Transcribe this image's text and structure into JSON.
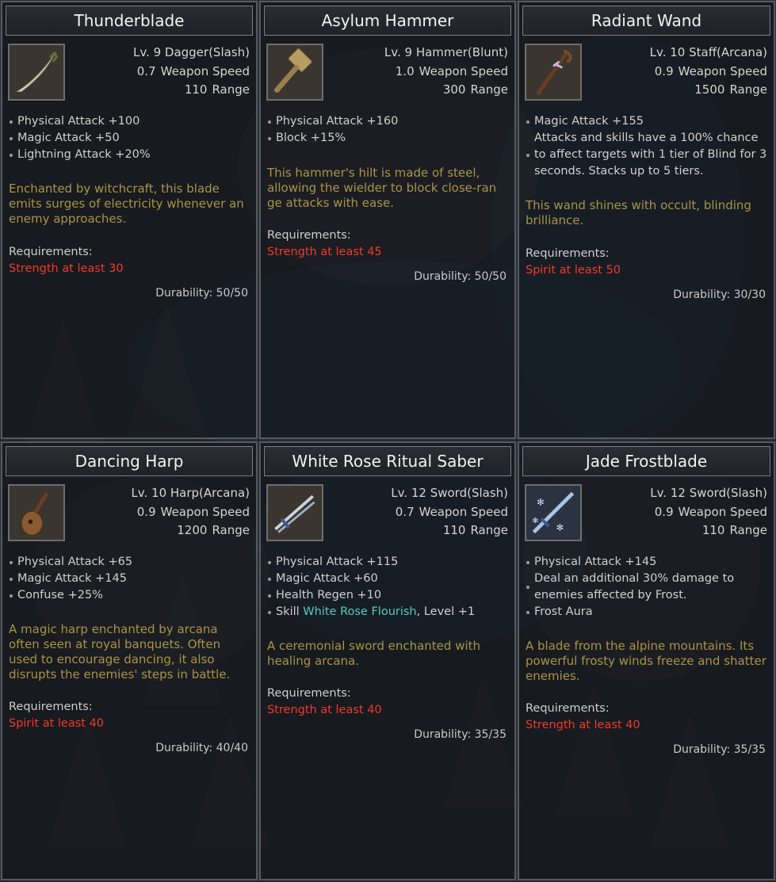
{
  "items": [
    {
      "name": "Thunderblade",
      "icon": "dagger-icon",
      "level_type": "Lv. 9 Dagger(Slash)",
      "speed_value": "0.7",
      "speed_label": "Weapon Speed",
      "range_value": "110",
      "range_label": "Range",
      "attributes": [
        "Physical Attack +100",
        "Magic Attack +50",
        "Lightning Attack +20%"
      ],
      "description": "Enchanted by witchcraft, this blade emits surges of electricity whenever an enemy approaches.",
      "requirements_label": "Requirements:",
      "requirement": "Strength at least 30",
      "durability": "Durability: 50/50"
    },
    {
      "name": "Asylum Hammer",
      "icon": "hammer-icon",
      "level_type": "Lv. 9 Hammer(Blunt)",
      "speed_value": "1.0",
      "speed_label": "Weapon Speed",
      "range_value": "300",
      "range_label": "Range",
      "attributes": [
        "Physical Attack +160",
        "Block +15%"
      ],
      "description": "This hammer's hilt is made of steel, allowing the wielder to block close-ran ge attacks with ease.",
      "requirements_label": "Requirements:",
      "requirement": "Strength at least 45",
      "durability": "Durability: 50/50"
    },
    {
      "name": "Radiant Wand",
      "icon": "staff-icon",
      "level_type": "Lv. 10 Staff(Arcana)",
      "speed_value": "0.9",
      "speed_label": "Weapon Speed",
      "range_value": "1500",
      "range_label": "Range",
      "attributes": [
        "Magic Attack +155",
        "Attacks and skills have a 100% chance to affect targets with 1 tier of Blind for 3 seconds. Stacks up to 5 tiers."
      ],
      "description": "This wand shines with occult, blinding brilliance.",
      "requirements_label": "Requirements:",
      "requirement": "Spirit at least 50",
      "durability": "Durability: 30/30"
    },
    {
      "name": "Dancing Harp",
      "icon": "harp-icon",
      "level_type": "Lv. 10 Harp(Arcana)",
      "speed_value": "0.9",
      "speed_label": "Weapon Speed",
      "range_value": "1200",
      "range_label": "Range",
      "attributes": [
        "Physical Attack +65",
        "Magic Attack +145",
        "Confuse +25%"
      ],
      "description": "A magic harp enchanted by arcana often seen at royal banquets. Often used to encourage dancing, it also disrupts the enemies' steps in battle.",
      "requirements_label": "Requirements:",
      "requirement": "Spirit at least 40",
      "durability": "Durability: 40/40"
    },
    {
      "name": "White Rose Ritual Saber",
      "icon": "sword-icon",
      "level_type": "Lv. 12 Sword(Slash)",
      "speed_value": "0.7",
      "speed_label": "Weapon Speed",
      "range_value": "110",
      "range_label": "Range",
      "attributes": [
        "Physical Attack +115",
        "Magic Attack +60",
        "Health Regen +10"
      ],
      "skill": {
        "prefix": "Skill ",
        "name": "White Rose Flourish",
        "suffix": ", Level +1"
      },
      "description": "A ceremonial sword enchanted with healing arcana.",
      "requirements_label": "Requirements:",
      "requirement": "Strength at least 40",
      "durability": "Durability: 35/35"
    },
    {
      "name": "Jade Frostblade",
      "icon": "frost-sword-icon",
      "level_type": "Lv. 12 Sword(Slash)",
      "speed_value": "0.9",
      "speed_label": "Weapon Speed",
      "range_value": "110",
      "range_label": "Range",
      "attributes": [
        "Physical Attack +145",
        "Deal an additional 30% damage to enemies affected by Frost.",
        "Frost Aura"
      ],
      "description": "A blade from the alpine mountains. Its powerful frosty winds freeze and shatter enemies.",
      "requirements_label": "Requirements:",
      "requirement": "Strength at least 40",
      "durability": "Durability: 35/35"
    }
  ]
}
